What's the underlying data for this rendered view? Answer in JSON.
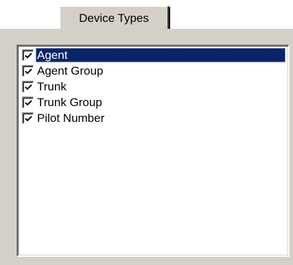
{
  "tab": {
    "label": "Device Types"
  },
  "device_types": {
    "items": [
      {
        "label": "Agent",
        "checked": true,
        "selected": true
      },
      {
        "label": "Agent Group",
        "checked": true,
        "selected": false
      },
      {
        "label": "Trunk",
        "checked": true,
        "selected": false
      },
      {
        "label": "Trunk Group",
        "checked": true,
        "selected": false
      },
      {
        "label": "Pilot Number",
        "checked": true,
        "selected": false
      }
    ]
  },
  "colors": {
    "selection": "#0a246a",
    "face": "#d4d0c8"
  },
  "icons": {
    "check": "checkmark-icon"
  }
}
